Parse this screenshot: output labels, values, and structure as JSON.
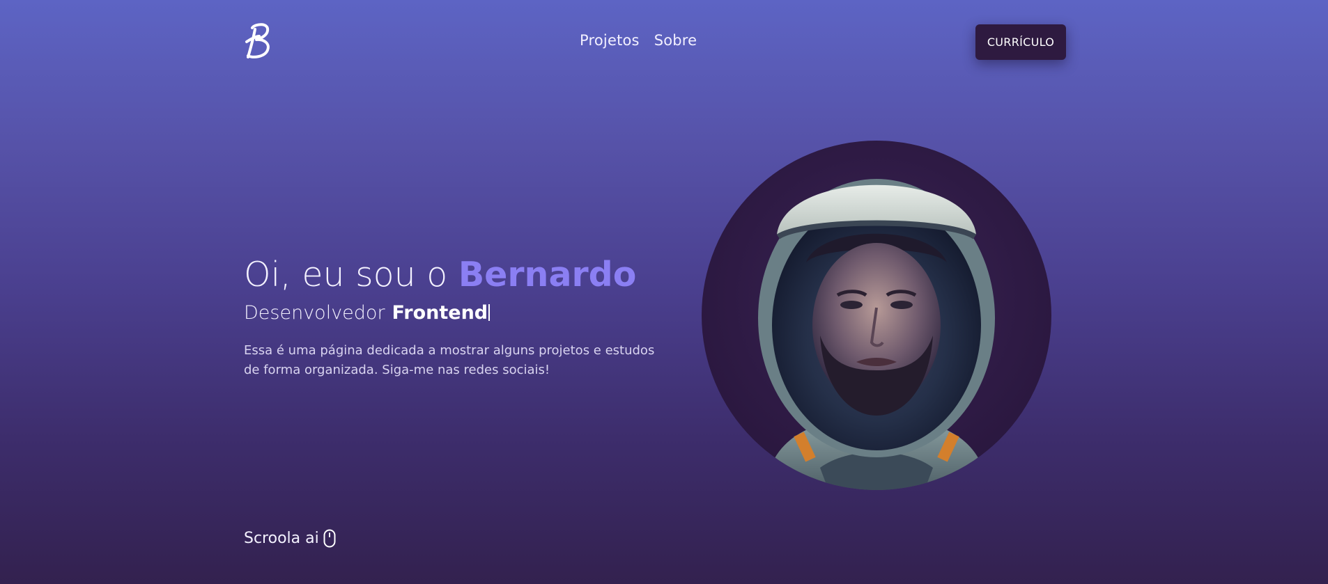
{
  "header": {
    "logo_letter": "B",
    "nav": [
      {
        "label": "Projetos"
      },
      {
        "label": "Sobre"
      }
    ],
    "cv_button_label": "CURRÍCULO"
  },
  "hero": {
    "greeting_prefix": "Oi, eu sou o",
    "name": "Bernardo",
    "role_prefix": "Desenvolvedor",
    "role_highlight": "Frontend",
    "description": "Essa é uma página dedicada a mostrar alguns projetos e estudos de forma organizada. Siga-me nas redes sociais!"
  },
  "portrait": {
    "icon": "astronaut-portrait"
  },
  "scroll": {
    "label": "Scroola ai",
    "icon": "mouse-icon"
  },
  "colors": {
    "accent": "#8b7ff3",
    "button_bg": "#2e1a40",
    "gradient_top": "#5d64c4",
    "gradient_bottom": "#33214f"
  }
}
